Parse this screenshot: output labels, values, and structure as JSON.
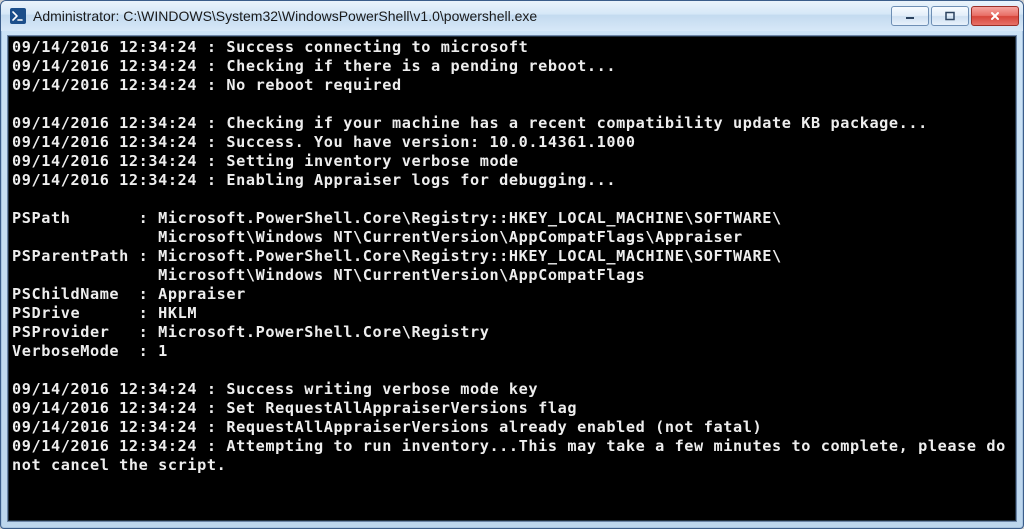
{
  "titlebar": {
    "title": "Administrator: C:\\WINDOWS\\System32\\WindowsPowerShell\\v1.0\\powershell.exe",
    "icon_name": "powershell-icon"
  },
  "console": {
    "lines": [
      "09/14/2016 12:34:24 : Success connecting to microsoft",
      "09/14/2016 12:34:24 : Checking if there is a pending reboot...",
      "09/14/2016 12:34:24 : No reboot required",
      "",
      "09/14/2016 12:34:24 : Checking if your machine has a recent compatibility update KB package...",
      "09/14/2016 12:34:24 : Success. You have version: 10.0.14361.1000",
      "09/14/2016 12:34:24 : Setting inventory verbose mode",
      "09/14/2016 12:34:24 : Enabling Appraiser logs for debugging...",
      "",
      "PSPath       : Microsoft.PowerShell.Core\\Registry::HKEY_LOCAL_MACHINE\\SOFTWARE\\",
      "               Microsoft\\Windows NT\\CurrentVersion\\AppCompatFlags\\Appraiser",
      "PSParentPath : Microsoft.PowerShell.Core\\Registry::HKEY_LOCAL_MACHINE\\SOFTWARE\\",
      "               Microsoft\\Windows NT\\CurrentVersion\\AppCompatFlags",
      "PSChildName  : Appraiser",
      "PSDrive      : HKLM",
      "PSProvider   : Microsoft.PowerShell.Core\\Registry",
      "VerboseMode  : 1",
      "",
      "09/14/2016 12:34:24 : Success writing verbose mode key",
      "09/14/2016 12:34:24 : Set RequestAllAppraiserVersions flag",
      "09/14/2016 12:34:24 : RequestAllAppraiserVersions already enabled (not fatal)",
      "09/14/2016 12:34:24 : Attempting to run inventory...This may take a few minutes to complete, please do not cancel the script."
    ]
  }
}
